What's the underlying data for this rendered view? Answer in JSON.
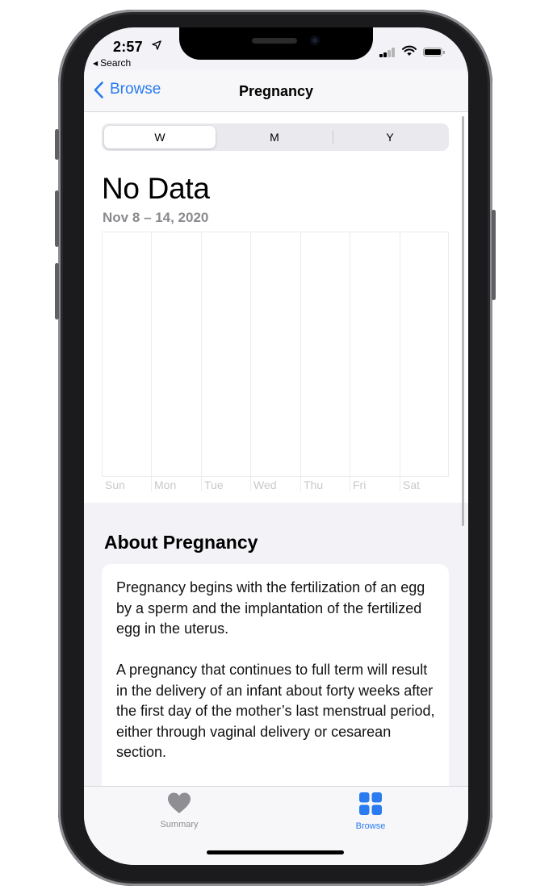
{
  "status_bar": {
    "time": "2:57",
    "back_app": "Search",
    "back_app_glyph": "◀",
    "location_glyph": "location-arrow-icon"
  },
  "nav": {
    "back_label": "Browse",
    "title": "Pregnancy"
  },
  "segmented": {
    "options": [
      "W",
      "M",
      "Y"
    ],
    "selected": "W"
  },
  "chart_data": {
    "type": "bar",
    "title": "",
    "value_text": "No Data",
    "subtitle": "Nov 8 – 14, 2020",
    "categories": [
      "Sun",
      "Mon",
      "Tue",
      "Wed",
      "Thu",
      "Fri",
      "Sat"
    ],
    "series": [
      {
        "values": [
          null,
          null,
          null,
          null,
          null,
          null,
          null
        ]
      }
    ],
    "xlabel": "",
    "ylabel": "",
    "grid": true
  },
  "about": {
    "title": "About Pregnancy",
    "paragraphs": [
      "Pregnancy begins with the fertilization of an egg by a sperm and the implantation of the fertilized egg in the uterus.",
      "A pregnancy that continues to full term will result in the delivery of an infant about forty weeks after the first day of the mother’s last menstrual period, either through vaginal delivery or cesarean section."
    ]
  },
  "tabbar": {
    "tabs": [
      {
        "label": "Summary",
        "icon": "heart-icon",
        "active": false
      },
      {
        "label": "Browse",
        "icon": "grid-icon",
        "active": true
      }
    ]
  },
  "colors": {
    "accent": "#2a7bf0",
    "inactive_tab": "#8e8e93",
    "secondary_text": "#8a8a8e"
  }
}
